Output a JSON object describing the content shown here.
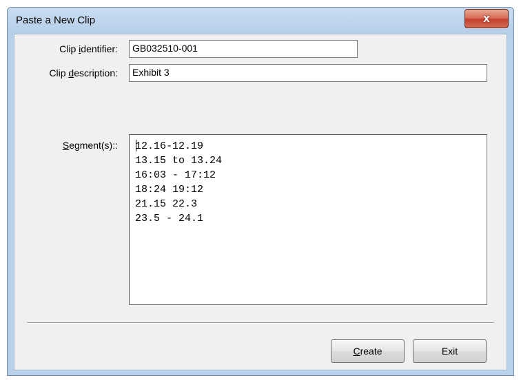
{
  "window": {
    "title": "Paste a New Clip",
    "close_glyph": "x"
  },
  "form": {
    "identifier_label": {
      "pre": "Clip ",
      "key": "i",
      "post": "dentifier:"
    },
    "identifier_value": "GB032510-001",
    "description_label": {
      "pre": "Clip ",
      "key": "d",
      "post": "escription:"
    },
    "description_value": "Exhibit 3",
    "segments_label": {
      "pre": "",
      "key": "S",
      "post": "egment(s)::"
    },
    "segments": [
      "12.16-12.19",
      "13.15 to 13.24",
      "16:03 - 17:12",
      "18:24 19:12",
      "21.15 22.3",
      "23.5 - 24.1"
    ]
  },
  "buttons": {
    "create": {
      "key": "C",
      "rest": "reate"
    },
    "exit": "Exit"
  }
}
